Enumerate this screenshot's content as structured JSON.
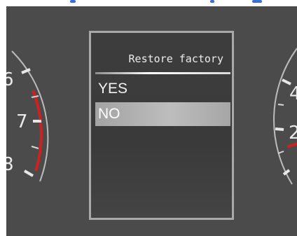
{
  "menu": {
    "title": "Restore factory",
    "items": [
      {
        "label": "YES",
        "selected": false
      },
      {
        "label": "NO",
        "selected": true
      }
    ]
  },
  "left_gauge": {
    "labels": [
      "6",
      "7",
      "8"
    ],
    "redline_color": "#cc2222"
  },
  "right_gauge": {
    "labels": [
      "4",
      "2"
    ],
    "needle_color": "#cc2222"
  },
  "colors": {
    "panel": "#4b4b4b",
    "menu_border": "#a9a9a9",
    "selection": "#b3b3b3",
    "accent": "#3b6fd8"
  }
}
